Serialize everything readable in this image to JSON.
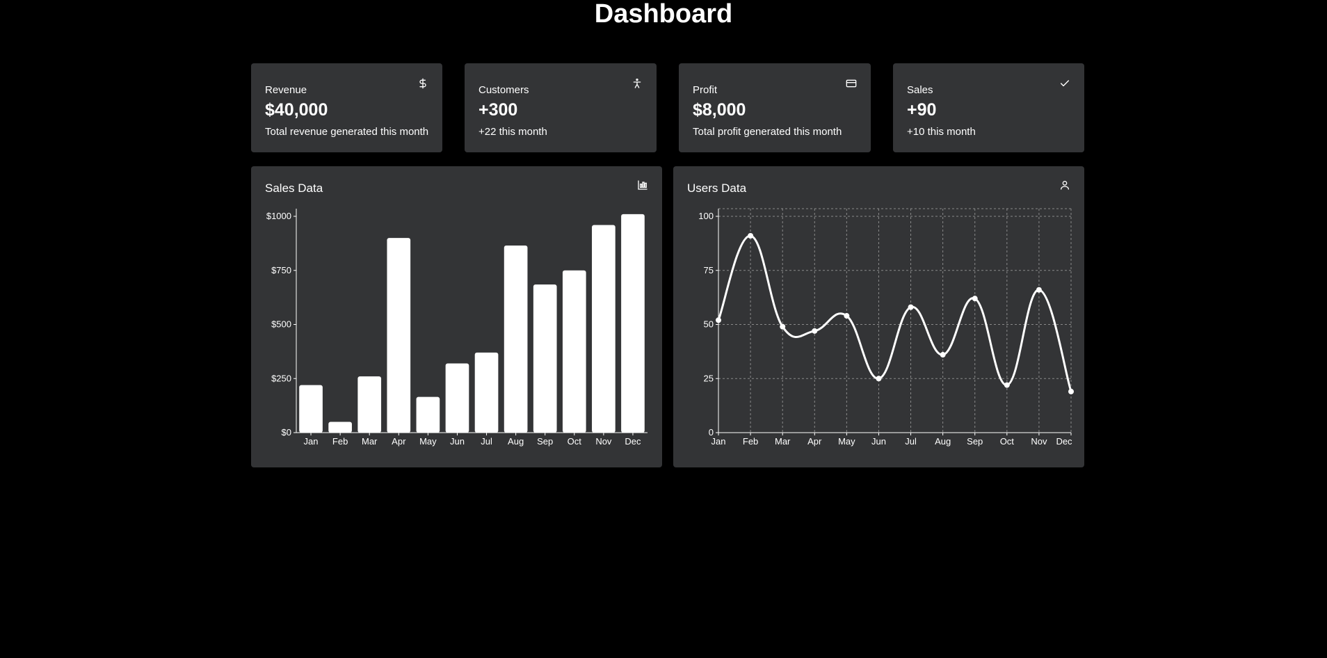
{
  "page": {
    "title": "Dashboard"
  },
  "colors": {
    "background": "#000000",
    "card": "#333436",
    "foreground": "#ffffff",
    "grid": "#8a8a8a"
  },
  "stats": [
    {
      "title": "Revenue",
      "value": "$40,000",
      "sub": "Total revenue generated this month",
      "icon": "dollar-icon"
    },
    {
      "title": "Customers",
      "value": "+300",
      "sub": "+22 this month",
      "icon": "accessibility-icon"
    },
    {
      "title": "Profit",
      "value": "$8,000",
      "sub": "Total profit generated this month",
      "icon": "credit-card-icon"
    },
    {
      "title": "Sales",
      "value": "+90",
      "sub": "+10 this month",
      "icon": "check-icon"
    }
  ],
  "sales_panel": {
    "title": "Sales Data",
    "icon": "bar-chart-icon"
  },
  "users_panel": {
    "title": "Users Data",
    "icon": "user-icon"
  },
  "chart_data": [
    {
      "type": "bar",
      "title": "Sales Data",
      "categories": [
        "Jan",
        "Feb",
        "Mar",
        "Apr",
        "May",
        "Jun",
        "Jul",
        "Aug",
        "Sep",
        "Oct",
        "Nov",
        "Dec"
      ],
      "values": [
        220,
        50,
        260,
        900,
        165,
        320,
        370,
        865,
        685,
        750,
        960,
        1010
      ],
      "ylim": [
        0,
        1000
      ],
      "yticks": [
        0,
        250,
        500,
        750,
        1000
      ],
      "ytick_labels": [
        "$0",
        "$250",
        "$500",
        "$750",
        "$1000"
      ],
      "grid": false,
      "color": "#ffffff"
    },
    {
      "type": "line",
      "title": "Users Data",
      "categories": [
        "Jan",
        "Feb",
        "Mar",
        "Apr",
        "May",
        "Jun",
        "Jul",
        "Aug",
        "Sep",
        "Oct",
        "Nov",
        "Dec"
      ],
      "values": [
        52,
        91,
        49,
        47,
        54,
        25,
        58,
        36,
        62,
        22,
        66,
        19
      ],
      "ylim": [
        0,
        100
      ],
      "yticks": [
        0,
        25,
        50,
        75,
        100
      ],
      "ytick_labels": [
        "0",
        "25",
        "50",
        "75",
        "100"
      ],
      "grid": true,
      "curve": "smooth",
      "color": "#ffffff"
    }
  ]
}
